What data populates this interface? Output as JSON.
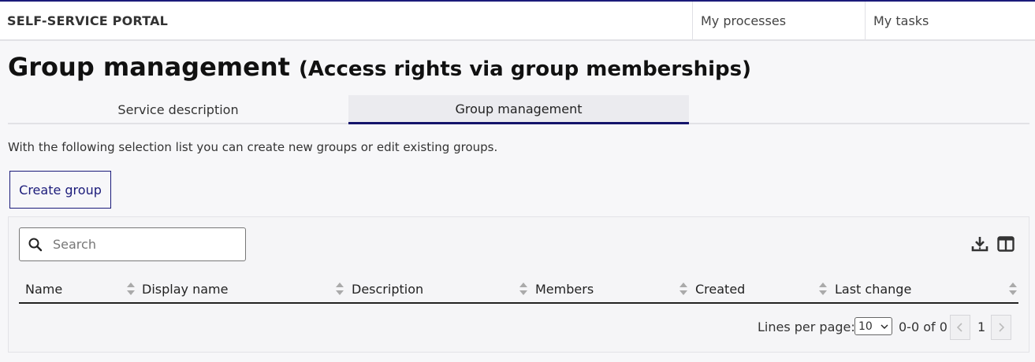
{
  "header": {
    "brand": "SELF-SERVICE PORTAL",
    "nav": [
      {
        "label": "My processes"
      },
      {
        "label": "My tasks"
      }
    ]
  },
  "page": {
    "title": "Group management",
    "subtitle": "(Access rights via group memberships)"
  },
  "tabs": [
    {
      "label": "Service description",
      "active": false
    },
    {
      "label": "Group management",
      "active": true
    }
  ],
  "intro": "With the following selection list you can create new groups or edit existing groups.",
  "create_button": "Create group",
  "table": {
    "search_placeholder": "Search",
    "columns": [
      "Name",
      "Display name",
      "Description",
      "Members",
      "Created",
      "Last change"
    ],
    "rows": []
  },
  "pagination": {
    "lines_per_page_label": "Lines per page:",
    "lines_per_page": "10",
    "range": "0-0 of 0",
    "page": "1"
  },
  "colors": {
    "accent": "#14146b",
    "top_border": "#1a1a7a",
    "background": "#f7f7f9"
  }
}
